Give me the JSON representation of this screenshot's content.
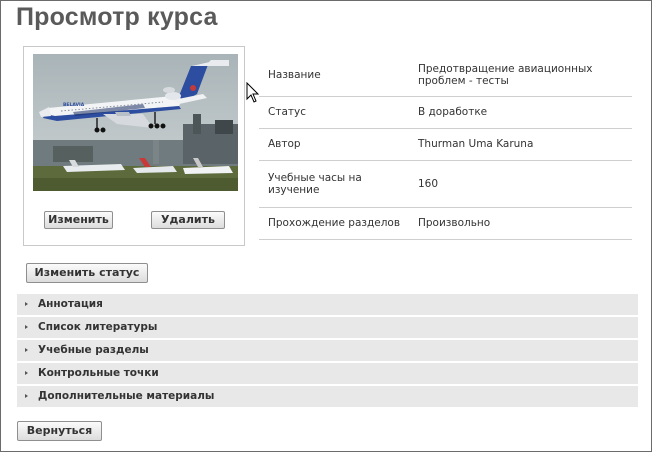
{
  "page": {
    "title": "Просмотр курса"
  },
  "photo": {
    "alt": "Самолет авиакомпании над аэропортом",
    "livery_text": "BELAVIA"
  },
  "photo_actions": {
    "edit_label": "Изменить",
    "delete_label": "Удалить"
  },
  "details": [
    {
      "label": "Название",
      "value": "Предотвращение авиационных проблем - тесты"
    },
    {
      "label": "Статус",
      "value": "В доработке"
    },
    {
      "label": "Автор",
      "value": "Thurman Uma Karuna"
    },
    {
      "label": "Учебные часы на изучение",
      "value": "160"
    },
    {
      "label": "Прохождение разделов",
      "value": "Произвольно"
    }
  ],
  "change_status_label": "Изменить статус",
  "sections": [
    {
      "label": "Аннотация"
    },
    {
      "label": "Список литературы"
    },
    {
      "label": "Учебные разделы"
    },
    {
      "label": "Контрольные точки"
    },
    {
      "label": "Дополнительные материалы"
    }
  ],
  "back_label": "Вернуться",
  "colors": {
    "section_bg": "#e8e8e8",
    "title": "#5a5a5a",
    "row_divider": "#cfcfcf"
  }
}
